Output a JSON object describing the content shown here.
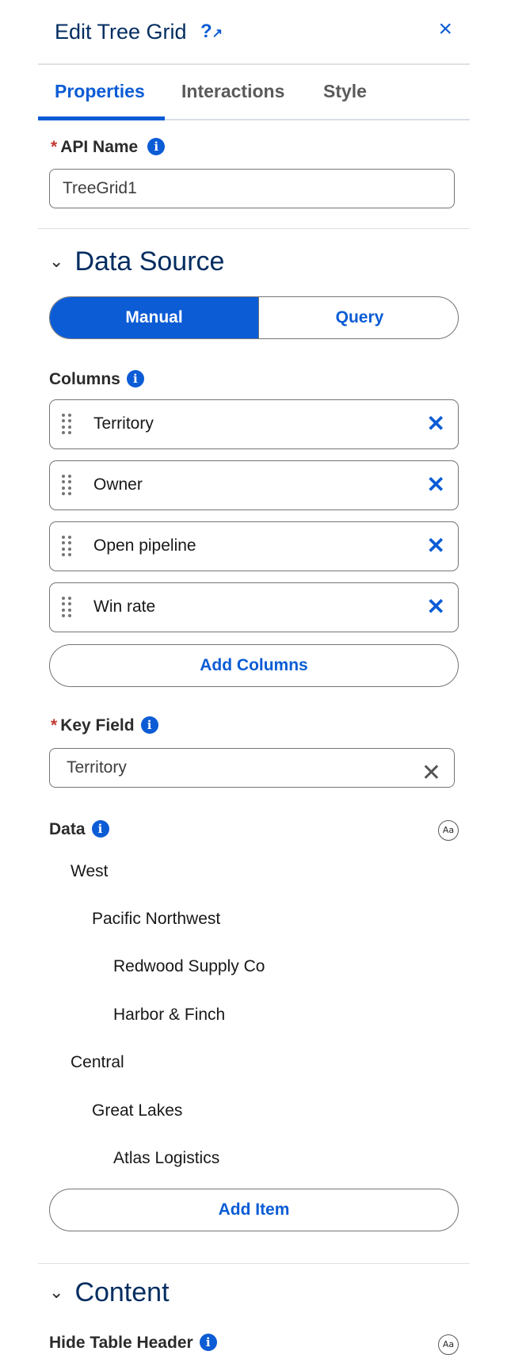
{
  "header": {
    "title": "Edit Tree Grid",
    "help_glyph": "?",
    "help_sub": "↗",
    "close_glyph": "×"
  },
  "tabs": [
    {
      "label": "Properties",
      "active": true
    },
    {
      "label": "Interactions",
      "active": false
    },
    {
      "label": "Style",
      "active": false
    }
  ],
  "api_name": {
    "required_mark": "*",
    "label": "API Name",
    "value": "TreeGrid1"
  },
  "data_source": {
    "section_title": "Data Source",
    "segments": [
      "Manual",
      "Query"
    ],
    "selected": "Manual",
    "columns_label": "Columns",
    "columns": [
      "Territory",
      "Owner",
      "Open pipeline",
      "Win rate"
    ],
    "add_columns_label": "Add Columns",
    "key_field": {
      "required_mark": "*",
      "label": "Key Field",
      "value": "Territory"
    },
    "data_label": "Data",
    "tree": [
      {
        "label": "West",
        "level": 0
      },
      {
        "label": "Pacific Northwest",
        "level": 1
      },
      {
        "label": "Redwood Supply Co",
        "level": 2
      },
      {
        "label": "Harbor & Finch",
        "level": 2
      },
      {
        "label": "Central",
        "level": 0
      },
      {
        "label": "Great Lakes",
        "level": 1
      },
      {
        "label": "Atlas Logistics",
        "level": 2
      }
    ],
    "add_item_label": "Add Item"
  },
  "content": {
    "section_title": "Content",
    "hide_header_label": "Hide Table Header"
  },
  "icons": {
    "info": "i",
    "remove": "✕",
    "clear": "✕",
    "chevron": "⌄",
    "text_format": "Aa"
  },
  "colors": {
    "accent": "#0b5cd5",
    "title": "#032d60",
    "required": "#c23934"
  }
}
